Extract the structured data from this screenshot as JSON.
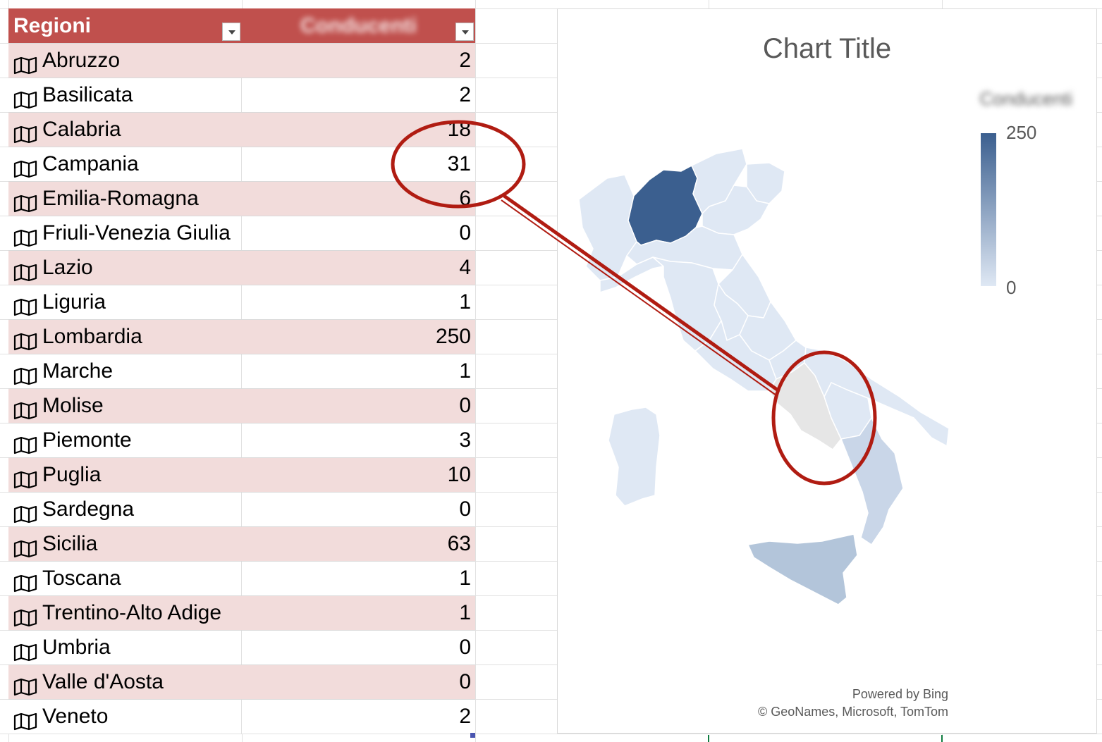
{
  "table": {
    "headers": [
      "Regioni",
      "Conducenti"
    ],
    "rows": [
      {
        "region": "Abruzzo",
        "value": "2"
      },
      {
        "region": "Basilicata",
        "value": "2"
      },
      {
        "region": "Calabria",
        "value": "18"
      },
      {
        "region": "Campania",
        "value": "31"
      },
      {
        "region": "Emilia-Romagna",
        "value": "6"
      },
      {
        "region": "Friuli-Venezia Giulia",
        "value": "0"
      },
      {
        "region": "Lazio",
        "value": "4"
      },
      {
        "region": "Liguria",
        "value": "1"
      },
      {
        "region": "Lombardia",
        "value": "250"
      },
      {
        "region": "Marche",
        "value": "1"
      },
      {
        "region": "Molise",
        "value": "0"
      },
      {
        "region": "Piemonte",
        "value": "3"
      },
      {
        "region": "Puglia",
        "value": "10"
      },
      {
        "region": "Sardegna",
        "value": "0"
      },
      {
        "region": "Sicilia",
        "value": "63"
      },
      {
        "region": "Toscana",
        "value": "1"
      },
      {
        "region": "Trentino-Alto Adige",
        "value": "1"
      },
      {
        "region": "Umbria",
        "value": "0"
      },
      {
        "region": "Valle d'Aosta",
        "value": "0"
      },
      {
        "region": "Veneto",
        "value": "2"
      }
    ]
  },
  "chart": {
    "title": "Chart Title",
    "legend_title": "Conducenti",
    "legend_max": "250",
    "legend_min": "0",
    "attribution_1": "Powered by Bing",
    "attribution_2": "© GeoNames, Microsoft, TomTom"
  },
  "colors": {
    "header": "#c0504d",
    "band": "#f2dcdb",
    "map_high": "#3b5f8f",
    "map_low": "#dfe8f4",
    "map_mid": "#b3c5da",
    "no_data": "#e6e6e6",
    "annotation": "#b01c12"
  },
  "icons": {
    "row_icon": "map-icon",
    "filter": "filter-dropdown-icon"
  }
}
